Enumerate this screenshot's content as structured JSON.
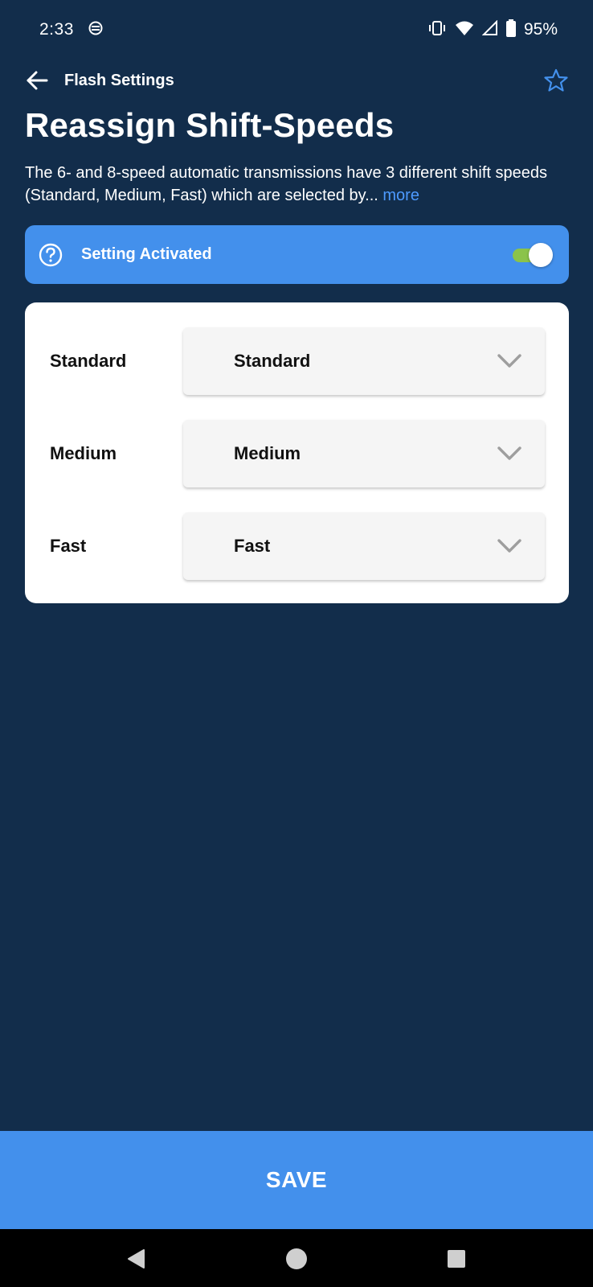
{
  "status_bar": {
    "time": "2:33",
    "battery_percent": "95%"
  },
  "app_bar": {
    "title": "Flash Settings"
  },
  "page": {
    "title": "Reassign Shift-Speeds",
    "description": "The 6- and 8-speed automatic transmissions have 3 different shift speeds (Standard, Medium, Fast) which are selected by...",
    "more_link": "more"
  },
  "activation": {
    "label": "Setting Activated",
    "enabled": true
  },
  "shift_speeds": [
    {
      "label": "Standard",
      "value": "Standard"
    },
    {
      "label": "Medium",
      "value": "Medium"
    },
    {
      "label": "Fast",
      "value": "Fast"
    }
  ],
  "footer": {
    "save_label": "SAVE"
  },
  "colors": {
    "background": "#122d4b",
    "accent": "#4390ec",
    "toggle_on": "#8bc34a",
    "link": "#4d9aff"
  }
}
